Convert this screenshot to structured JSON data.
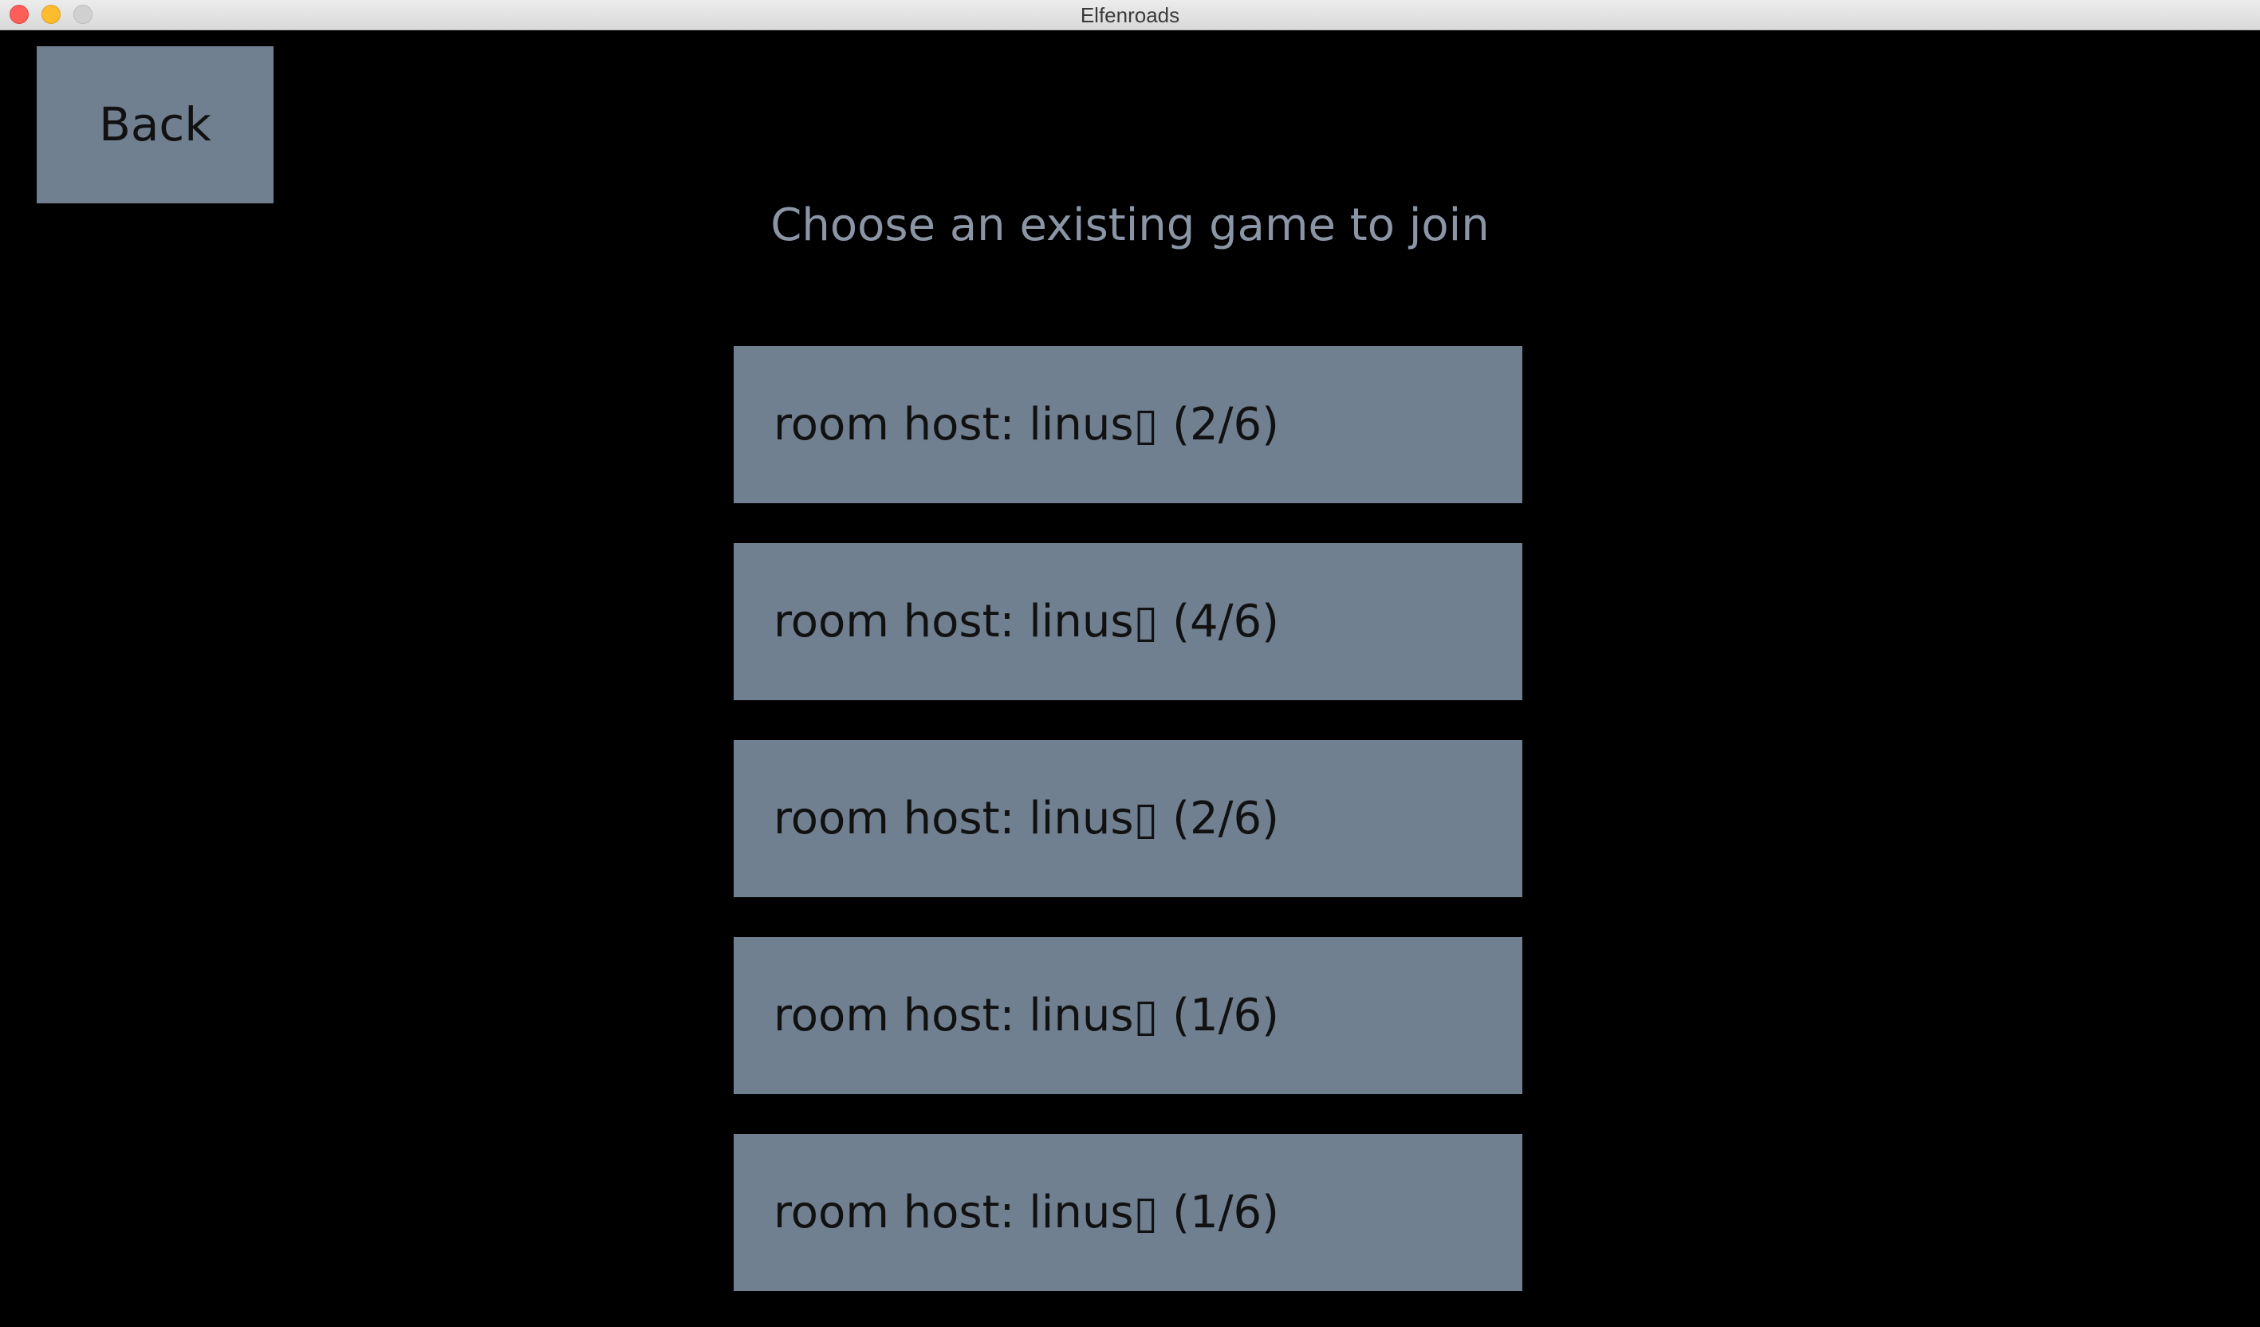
{
  "window": {
    "title": "Elfenroads"
  },
  "back_button": {
    "label": "Back"
  },
  "heading": "Choose an existing game to join",
  "rooms": [
    {
      "label": "room host: linus▯ (2/6)"
    },
    {
      "label": "room host: linus▯ (4/6)"
    },
    {
      "label": "room host: linus▯ (2/6)"
    },
    {
      "label": "room host: linus▯ (1/6)"
    },
    {
      "label": "room host: linus▯ (1/6)"
    }
  ],
  "colors": {
    "background": "#000000",
    "button": "#708090",
    "heading_text": "#8a96a6",
    "button_text": "#111111"
  }
}
